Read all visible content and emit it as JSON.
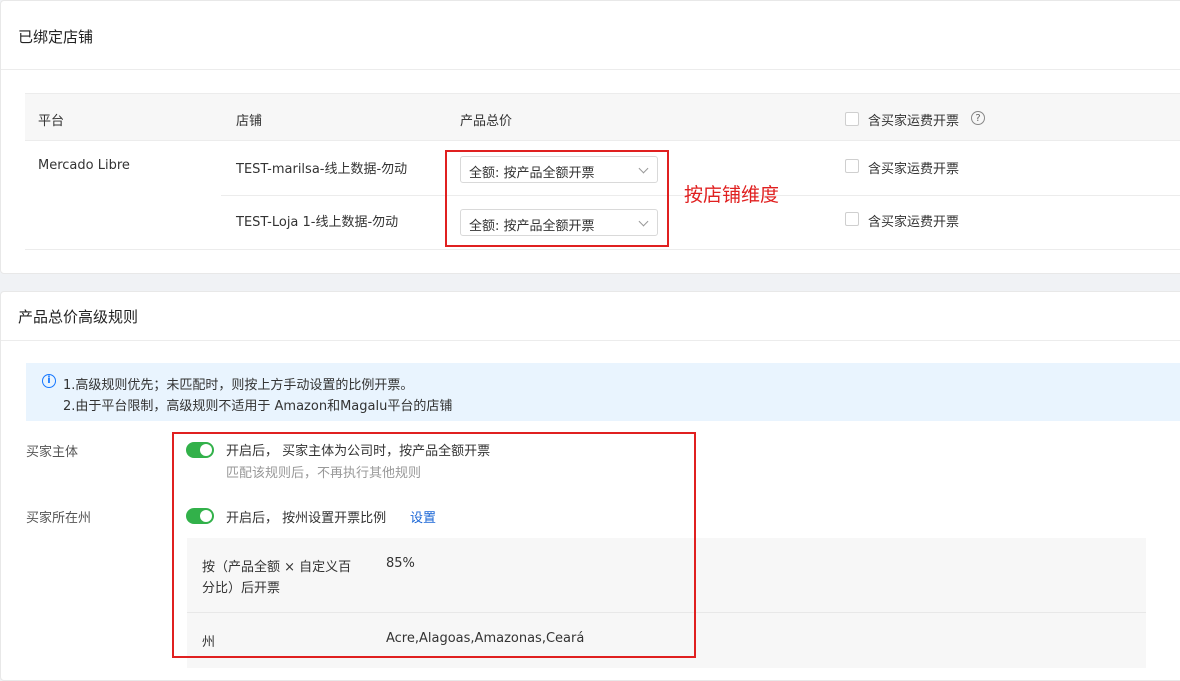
{
  "bound_stores": {
    "title": "已绑定店铺",
    "table": {
      "headers": {
        "platform": "平台",
        "store": "店铺",
        "total": "产品总价",
        "shipping": "含买家运费开票"
      },
      "rows": [
        {
          "platform": "Mercado Libre",
          "store": "TEST-marilsa-线上数据-勿动",
          "total": "全额: 按产品全额开票",
          "shipping": "含买家运费开票"
        },
        {
          "platform": "",
          "store": "TEST-Loja 1-线上数据-勿动",
          "total": "全额: 按产品全额开票",
          "shipping": "含买家运费开票"
        }
      ]
    },
    "annotation": "按店铺维度"
  },
  "advanced_rules": {
    "title": "产品总价高级规则",
    "info": {
      "line1": "1.高级规则优先；未匹配时，则按上方手动设置的比例开票。",
      "line2": "2.由于平台限制，高级规则不适用于 Amazon和Magalu平台的店铺"
    },
    "buyer_entity": {
      "label": "买家主体",
      "text": "开启后， 买家主体为公司时，按产品全额开票",
      "sub": "匹配该规则后，不再执行其他规则",
      "enabled": true
    },
    "buyer_state": {
      "label": "买家所在州",
      "text": "开启后， 按州设置开票比例",
      "link": "设置",
      "enabled": true,
      "details": {
        "ratio_label_1": "按（产品全额 × 自定义百",
        "ratio_label_2": "分比）后开票",
        "ratio_value": "85%",
        "state_label": "州",
        "state_value": "Acre,Alagoas,Amazonas,Ceará"
      }
    }
  },
  "colors": {
    "accent_red": "#e02020",
    "switch_on": "#32b14a",
    "link": "#1a66d6",
    "info_bg": "#e9f4fe"
  }
}
